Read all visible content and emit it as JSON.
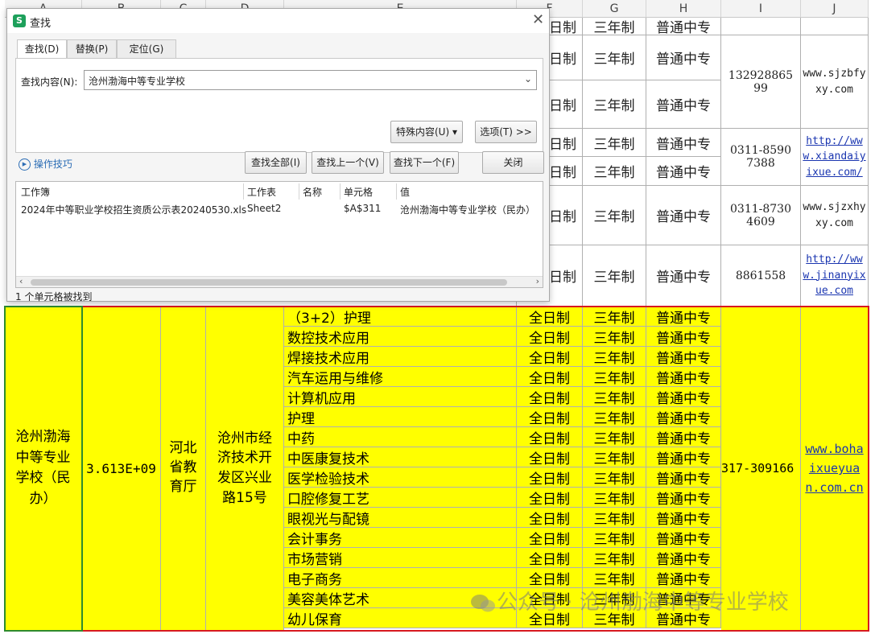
{
  "columns": [
    "A",
    "B",
    "C",
    "D",
    "E",
    "F",
    "G",
    "H",
    "I",
    "J"
  ],
  "upper_rows": [
    {
      "f": "日制",
      "g": "三年制",
      "h": "普通中专"
    },
    {
      "f": "日制",
      "g": "三年制",
      "h": "普通中专"
    },
    {
      "f": "日制",
      "g": "三年制",
      "h": "普通中专"
    },
    {
      "f": "日制",
      "g": "三年制",
      "h": "普通中专"
    },
    {
      "f": "日制",
      "g": "三年制",
      "h": "普通中专"
    },
    {
      "f": "日制",
      "g": "三年制",
      "h": "普通中专"
    },
    {
      "f": "日制",
      "g": "三年制",
      "h": "普通中专"
    }
  ],
  "upper_groups": [
    {
      "phone": "13292886599",
      "web": "www.sjzbfyxy.com",
      "link": false
    },
    {
      "phone": "0311-85907388",
      "web": "http://www.xiandaiyixue.com/",
      "link": true
    },
    {
      "phone": "0311-87304609",
      "web": "www.sjzxhyxy.com",
      "link": false
    },
    {
      "phone": "8861558",
      "web": "http://www.jinanyixue.com",
      "link": true
    }
  ],
  "school": {
    "name": "沧州渤海中等专业学校（民办）",
    "code": "3.613E+09",
    "authority": "河北省教育厅",
    "address": "沧州市经济技术开发区兴业路15号",
    "phone": "317-309166",
    "website": "www.bohaixueyuan.com.cn",
    "form": "全日制",
    "duration": "三年制",
    "level": "普通中专",
    "majors": [
      "（3+2）护理",
      "数控技术应用",
      "焊接技术应用",
      "汽车运用与维修",
      "计算机应用",
      "护理",
      "中药",
      "中医康复技术",
      "医学检验技术",
      "口腔修复工艺",
      "眼视光与配镜",
      "会计事务",
      "市场营销",
      "电子商务",
      "美容美体艺术",
      "幼儿保育"
    ]
  },
  "dialog": {
    "title": "查找",
    "tabs": [
      "查找(D)",
      "替换(P)",
      "定位(G)"
    ],
    "find_label": "查找内容(N):",
    "find_value": "沧州渤海中等专业学校",
    "special_btn": "特殊内容(U)",
    "options_btn": "选项(T) >>",
    "tips": "操作技巧",
    "find_all": "查找全部(I)",
    "find_prev": "查找上一个(V)",
    "find_next": "查找下一个(F)",
    "close": "关闭",
    "headers": [
      "工作簿",
      "工作表",
      "名称",
      "单元格",
      "值"
    ],
    "result": {
      "workbook": "2024年中等职业学校招生资质公示表20240530.xls",
      "sheet": "Sheet2",
      "name": "",
      "cell": "$A$311",
      "value": "沧州渤海中等专业学校（民办）"
    },
    "status": "1 个单元格被找到"
  },
  "watermark": {
    "prefix": "公众号 · ",
    "text": "沧州渤海中等专业学校"
  }
}
